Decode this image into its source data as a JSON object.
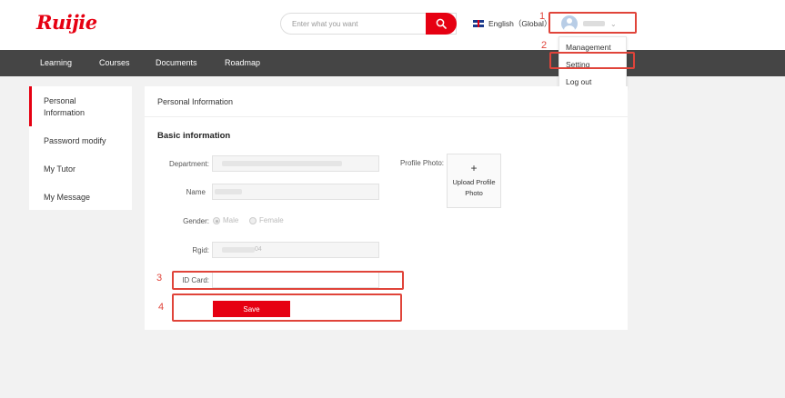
{
  "header": {
    "logo": "Ruijie",
    "search_placeholder": "Enter what you want",
    "language": "English（Global）"
  },
  "nav": {
    "items": [
      "Learning",
      "Courses",
      "Documents",
      "Roadmap"
    ]
  },
  "user_menu": {
    "items": [
      "Management",
      "Setting",
      "Log out"
    ]
  },
  "sidebar": {
    "items": [
      "Personal Information",
      "Password modify",
      "My Tutor",
      "My Message"
    ]
  },
  "panel": {
    "title": "Personal Information",
    "section_title": "Basic information",
    "fields": {
      "department_label": "Department:",
      "name_label": "Name",
      "gender_label": "Gender:",
      "gender_male": "Male",
      "gender_female": "Female",
      "rgid_label": "Rgid:",
      "rgid_value_suffix": "04",
      "id_card_label": "ID Card:",
      "profile_photo_label": "Profile Photo:"
    },
    "upload_plus": "+",
    "upload_label": "Upload Profile Photo",
    "save_label": "Save"
  },
  "annotations": [
    "1",
    "2",
    "3",
    "4"
  ],
  "colors": {
    "brand": "#e60012",
    "nav_bg": "#454545",
    "highlight": "#e0443a"
  },
  "icons": {
    "search": "search-icon",
    "flag": "uk-flag-icon",
    "avatar": "avatar-icon",
    "chevron": "chevron-down-icon"
  }
}
